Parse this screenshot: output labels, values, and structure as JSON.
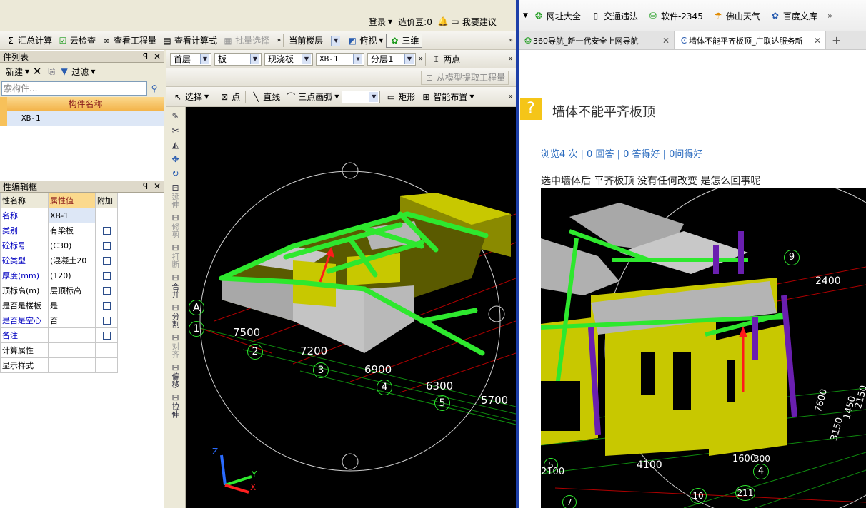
{
  "topbar": {
    "login": "登录",
    "price_points": "造价豆:0",
    "suggest": "我要建议"
  },
  "toolbar1": {
    "items": [
      "汇总计算",
      "云检查",
      "查看工程量",
      "查看计算式",
      "批量选择"
    ],
    "floor": "当前楼层",
    "view": "俯视",
    "three_d": "三维"
  },
  "component_list": {
    "title": "件列表",
    "new_btn": "新建",
    "filter": "过滤",
    "search_placeholder": "索构件...",
    "column_header": "构件名称",
    "items": [
      "XB-1"
    ]
  },
  "property_panel": {
    "title": "性编辑框",
    "headers": [
      "性名称",
      "属性值",
      "附加"
    ],
    "rows": [
      {
        "name": "名称",
        "value": "XB-1",
        "blue": true,
        "check": false
      },
      {
        "name": "类别",
        "value": "有梁板",
        "blue": true,
        "check": true
      },
      {
        "name": "砼标号",
        "value": "(C30)",
        "blue": true,
        "check": true
      },
      {
        "name": "砼类型",
        "value": "(混凝土20",
        "blue": true,
        "check": true
      },
      {
        "name": "厚度(mm)",
        "value": "(120)",
        "blue": true,
        "check": true
      },
      {
        "name": "顶标高(m)",
        "value": "层顶标高",
        "blue": false,
        "check": true
      },
      {
        "name": "是否是楼板",
        "value": "是",
        "blue": false,
        "check": true
      },
      {
        "name": "是否是空心",
        "value": "否",
        "blue": true,
        "check": true
      },
      {
        "name": "备注",
        "value": "",
        "blue": true,
        "check": true
      },
      {
        "name": "计算属性",
        "value": "",
        "blue": false,
        "check": false
      },
      {
        "name": "显示样式",
        "value": "",
        "blue": false,
        "check": false
      }
    ]
  },
  "toolbar2": {
    "floor": "首层",
    "type": "板",
    "subtype": "现浇板",
    "name": "XB-1",
    "layer": "分层1",
    "two_points": "两点"
  },
  "toolbar3": {
    "extract": "从模型提取工程量"
  },
  "toolbar4": {
    "select": "选择",
    "point": "点",
    "line": "直线",
    "arc": "三点画弧",
    "rect": "矩形",
    "smart": "智能布置"
  },
  "vertical_tools": {
    "labels": [
      "延伸",
      "修剪",
      "打断",
      "合并",
      "分割",
      "对齐",
      "偏移",
      "拉伸"
    ]
  },
  "viewport": {
    "axis_labels": [
      "A",
      "1",
      "2",
      "3",
      "4",
      "5"
    ],
    "dims": [
      "7500",
      "7200",
      "6900",
      "6300",
      "5700"
    ],
    "axis_xyz": [
      "Z",
      "Y",
      "X"
    ]
  },
  "browser": {
    "favorites": [
      "网址大全",
      "交通违法",
      "软件-2345",
      "佛山天气",
      "百度文库"
    ],
    "tabs": [
      "360导航_新一代安全上网导航",
      "墙体不能平齐板顶_广联达服务新"
    ],
    "question_title": "墙体不能平齐板顶",
    "stats": "浏览4 次 | 0 回答 | 0 答得好 | 0问得好",
    "body": "选中墙体后 平齐板顶 没有任何改变 是怎么回事呢",
    "image_labels": [
      "9",
      "2400",
      "4100",
      "1600",
      "300",
      "4",
      "10",
      "211",
      "7",
      "5",
      "2100",
      "3150",
      "1450",
      "2150",
      "7600"
    ]
  },
  "colors": {
    "green": "#2ee82e",
    "yellow": "#c8c800",
    "gray": "#a8a8a8",
    "purple": "#6a1fb0",
    "arrow": "#ff1a1a",
    "accent_bg": "#dad7cb"
  }
}
